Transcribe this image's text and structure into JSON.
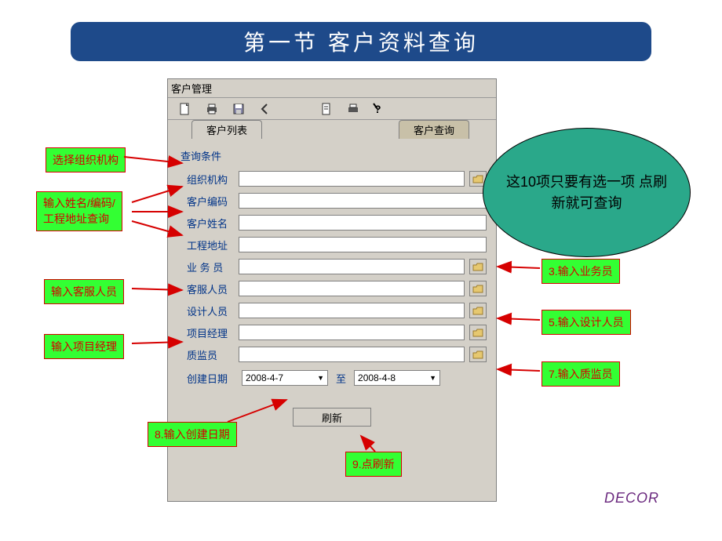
{
  "slide": {
    "title": "第一节   客户资料查询"
  },
  "app": {
    "window_title": "客户管理",
    "tabs": {
      "list": "客户列表",
      "query": "客户查询"
    },
    "fieldset_title": "查询条件",
    "fields": {
      "org_label": "组织机构",
      "customer_code_label": "客户编码",
      "customer_name_label": "客户姓名",
      "project_addr_label": "工程地址",
      "salesman_label": "业 务 员",
      "service_label": "客服人员",
      "designer_label": "设计人员",
      "pm_label": "项目经理",
      "qc_label": "质监员",
      "create_date_label": "创建日期",
      "date_from": "2008-4-7",
      "date_sep": "至",
      "date_to": "2008-4-8"
    },
    "refresh_label": "刷新"
  },
  "callouts": {
    "c1": "选择组织机构",
    "c2": "输入姓名/编码/工程地址查询",
    "c3": "输入客服人员",
    "c4": "输入项目经理",
    "r1": "3.输入业务员",
    "r2": "5.输入设计人员",
    "r3": "7.输入质监员",
    "c5": "8.输入创建日期",
    "c6": "9.点刷新"
  },
  "ellipse_text": "这10项只要有选一项   点刷新就可查询",
  "decor": "DECOR"
}
